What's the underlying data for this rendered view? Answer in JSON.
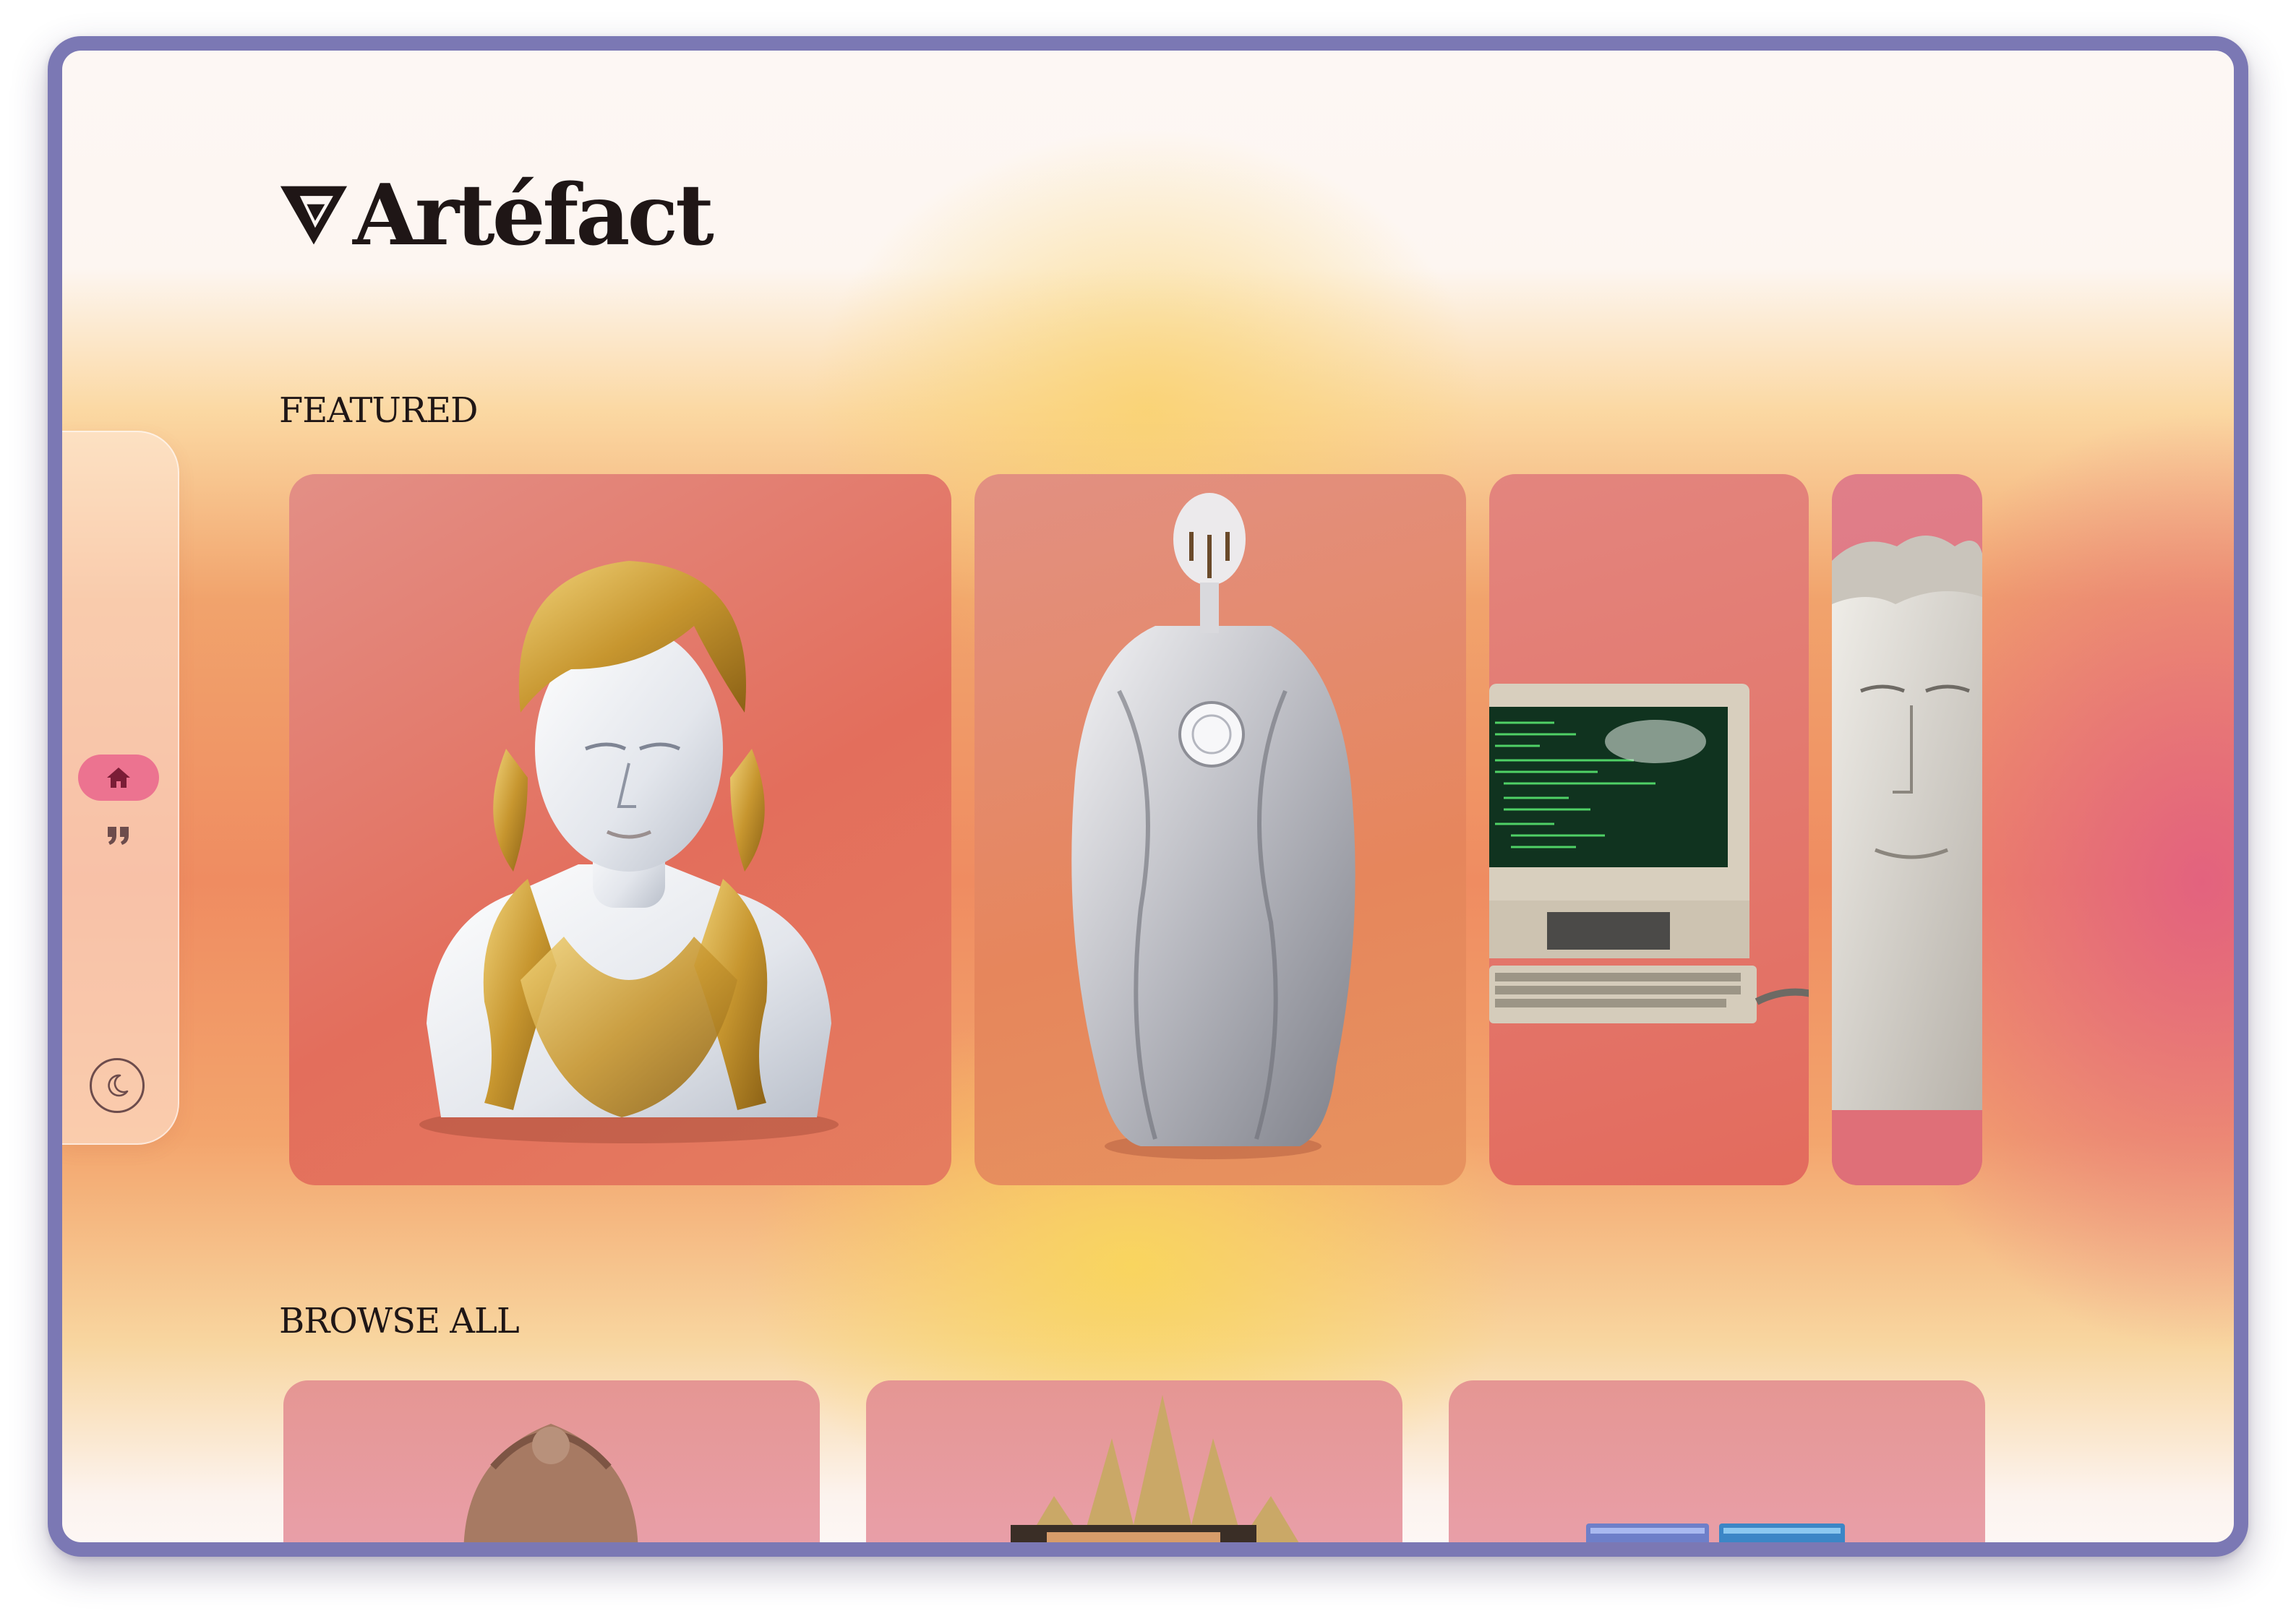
{
  "app": {
    "brand": "Artéfact",
    "logo_icon": "triangle-v-logo"
  },
  "sections": {
    "featured_title": "FEATURED",
    "browse_title": "BROWSE ALL"
  },
  "sidebar": {
    "items": [
      {
        "name": "home",
        "icon": "home-icon",
        "active": true
      },
      {
        "name": "quotes",
        "icon": "quote-icon",
        "active": false
      }
    ],
    "theme_toggle_icon": "moon-icon"
  },
  "featured": [
    {
      "subject": "marble-bust-with-gold-hair"
    },
    {
      "subject": "robed-silver-figure"
    },
    {
      "subject": "retro-computer"
    },
    {
      "subject": "marble-head"
    }
  ],
  "browse": [
    {
      "subject": "terracotta-head"
    },
    {
      "subject": "spiked-crown-object"
    },
    {
      "subject": "blue-panels"
    }
  ],
  "colors": {
    "accent": "#ec7390",
    "text": "#1f1616",
    "frame": "#7b78b4"
  }
}
